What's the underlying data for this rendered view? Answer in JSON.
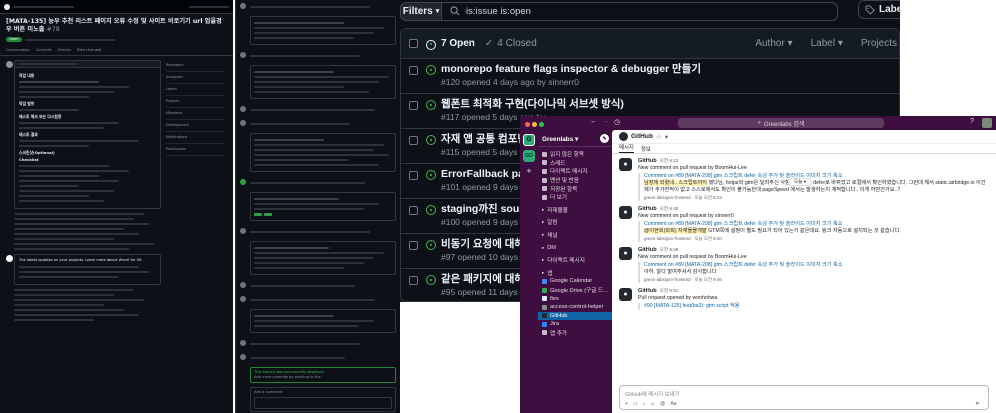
{
  "panel_issue": {
    "title": "[MATA-135] 능우 추천 리스트 페이지 오류 수정 및 사이트 비로기기 url 업을경우 버튼 미노출",
    "number": "#78",
    "status": "Open",
    "tabs": [
      "Conversation",
      "Commits",
      "Checks",
      "Files changed"
    ],
    "sections": [
      "작업 내용",
      "작업 범위",
      "테스트 체크 또는 다시원정",
      "테스트 결과",
      "스크린샷(Optional)",
      "Checklist"
    ],
    "bottom_title": "The latest updates on your projects. Learn more about Vercel for Git",
    "sidebar_labels": [
      "Reviewers",
      "Assignees",
      "Labels",
      "Projects",
      "Milestone",
      "Development",
      "Notifications",
      "Participants"
    ]
  },
  "panel_middle": {
    "success_text": "This branch was successfully deployed",
    "merged_text": "Add more commits by pushing to the",
    "comment_prompt": "Add a comment"
  },
  "issue_list": {
    "filters_label": "Filters",
    "query": "is:issue is:open",
    "labels_label": "Labels",
    "open_count": "7 Open",
    "closed_count": "4 Closed",
    "columns": [
      "Author",
      "Label",
      "Projects"
    ],
    "issues": [
      {
        "title": "monorepo feature flags inspector & debugger 만들기",
        "meta": "#120 opened 4 days ago by sinnerr0"
      },
      {
        "title": "웹폰트 최적화 구현(다이나믹 서브셋 방식)",
        "meta": "#117 opened 5 days ago by"
      },
      {
        "title": "자재 앱 공통 컴포넌트",
        "meta": "#115 opened 5 days ago"
      },
      {
        "title": "ErrorFallback page",
        "meta": "#101 opened 9 days ago by"
      },
      {
        "title": "staging까진 sourcer",
        "meta": "#100 opened 9 days ago by"
      },
      {
        "title": "비동기 요청에 대해서 S",
        "meta": "#97 opened 10 days ago by"
      },
      {
        "title": "같은 패키지에 대해 여러",
        "meta": "#95 opened 11 days ago by"
      }
    ]
  },
  "slack": {
    "search_placeholder": "Greenlabs 검색",
    "workspace": "Greenlabs",
    "sidebar_items": [
      "읽지 않은 항목",
      "스레드",
      "다이렉트 메시지",
      "멘션 및 반응",
      "저장된 항목",
      "더 보기"
    ],
    "sections": [
      "자재몰몰",
      "알림",
      "채널",
      "DM",
      "다이렉트 메시지",
      "앱"
    ],
    "apps": [
      "Google Calendar",
      "Google Drive (구글 드...",
      "flex",
      "access-control-helper",
      "GitHub",
      "Jira",
      "앱 추가"
    ],
    "channel_name": "GitHub",
    "channel_tabs": [
      "메시지",
      "정보"
    ],
    "today_label": "오늘",
    "messages": [
      {
        "sender": "GitHub",
        "time": "오전 9:23",
        "summary": "New comment on pull request by BoomHui-Lee",
        "link": "Comment on #89 [MATA-208] gtm 스크립트 defer 속성 추가 및 슬라이드 이미지 크기 축소",
        "body_highlight": "남장재 되렸네.. 스크립트까지",
        "body": "했다님, hotjar와 gtm은 딜려주신 사항 적용해서. defer로 바뀌었고 로컬에서 확인하였습니다. 그런데 해서 static.airbridge.io 이건 제가 추가한적이 없고 스스로에서도 확인이 불가능한데 pageSpeed 에서는 발생하는지 계적합니다.. 이게 어떤건가요..?",
        "footer": "green-labs/gsn-frontend · 오늘 오전 9:23"
      },
      {
        "sender": "GitHub",
        "time": "오전 9:40",
        "summary": "New comment on pull request by sinnerr0",
        "link": "Comment on #89 [MATA-208] gtm 스크립트 defer 속성 추가 및 슬라이드 이미지 크기 축소",
        "body_highlight": "@이현희(희희) 자재몰몰개발",
        "body": "GTM쪽에 설정이 별도 필요가 되어 있는거 같은데요. 링크 자동으로 설치되는 것 같습니다.",
        "footer": "green-labs/gsn-frontend · 오늘 오전 9:40"
      },
      {
        "sender": "GitHub",
        "time": "오전 9:46",
        "summary": "New comment on pull request by BoomHui-Lee",
        "link": "Comment on #89 [MATA-208] gtm 스크립트 defer 속성 추가 및 슬라이드 이미지 크기 축소",
        "body_highlight": "",
        "body": "아하, 알다 발여주셔서 감사합니다",
        "footer": "green-labs/gsn-frontend · 오늘 오전 9:46"
      },
      {
        "sender": "GitHub",
        "time": "오전 9:51",
        "summary": "Pull request opened by wonhohwa",
        "link": "#90 [MATA-125] feat(ba3): gtm script 적용",
        "body_highlight": "",
        "body": "",
        "footer": ""
      }
    ],
    "input_placeholder": "GitHub에 메시지 보내기"
  }
}
